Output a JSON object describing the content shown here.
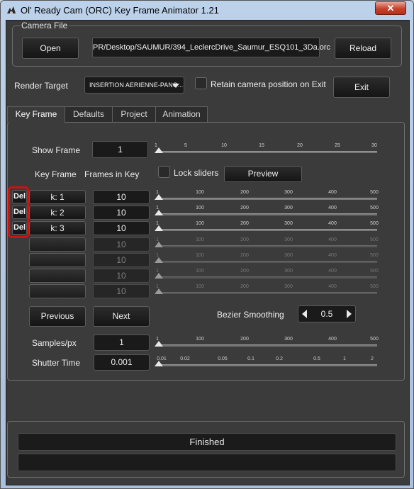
{
  "window": {
    "title": "Ol' Ready Cam (ORC) Key Frame Animator 1.21",
    "close_label": "✕"
  },
  "camera_file": {
    "group_label": "Camera File",
    "open_label": "Open",
    "path": "PR/Desktop/SAUMUR/394_LeclercDrive_Saumur_ESQ101_3Da.orc",
    "reload_label": "Reload"
  },
  "render_target": {
    "label": "Render Target",
    "selected": "INSERTION AERIENNE-PANO...",
    "retain_label": "Retain camera position on Exit",
    "retain_checked": false,
    "exit_label": "Exit"
  },
  "tabs": [
    {
      "label": "Key Frame",
      "active": true
    },
    {
      "label": "Defaults",
      "active": false
    },
    {
      "label": "Project",
      "active": false
    },
    {
      "label": "Animation",
      "active": false
    }
  ],
  "show_frame": {
    "label": "Show Frame",
    "value": "1",
    "ticks": [
      "1",
      "5",
      "10",
      "15",
      "20",
      "25",
      "30"
    ]
  },
  "columns": {
    "key_frame": "Key Frame",
    "frames_in_key": "Frames in Key"
  },
  "lock_sliders": {
    "label": "Lock sliders",
    "checked": false
  },
  "preview_label": "Preview",
  "keyframe_ticks": [
    "1",
    "100",
    "200",
    "300",
    "400",
    "500"
  ],
  "keyframes": [
    {
      "del": "Del",
      "key": "k: 1",
      "frames": "10",
      "enabled": true
    },
    {
      "del": "Del",
      "key": "k: 2",
      "frames": "10",
      "enabled": true
    },
    {
      "del": "Del",
      "key": "k: 3",
      "frames": "10",
      "enabled": true
    },
    {
      "del": "",
      "key": "",
      "frames": "10",
      "enabled": false
    },
    {
      "del": "",
      "key": "",
      "frames": "10",
      "enabled": false
    },
    {
      "del": "",
      "key": "",
      "frames": "10",
      "enabled": false
    },
    {
      "del": "",
      "key": "",
      "frames": "10",
      "enabled": false
    }
  ],
  "nav": {
    "previous_label": "Previous",
    "next_label": "Next"
  },
  "bezier": {
    "label": "Bezier Smoothing",
    "value": "0.5"
  },
  "samples": {
    "label": "Samples/px",
    "value": "1",
    "ticks": [
      "1",
      "100",
      "200",
      "300",
      "400",
      "500"
    ]
  },
  "shutter": {
    "label": "Shutter Time",
    "value": "0.001",
    "ticks": [
      "0.01",
      "0.02",
      "0.05",
      "0.1",
      "0.2",
      "0.5",
      "1",
      "2"
    ]
  },
  "status": {
    "message": "Finished",
    "secondary": ""
  },
  "colors": {
    "highlight": "#d40f0f",
    "panel": "#3b3b3b"
  }
}
